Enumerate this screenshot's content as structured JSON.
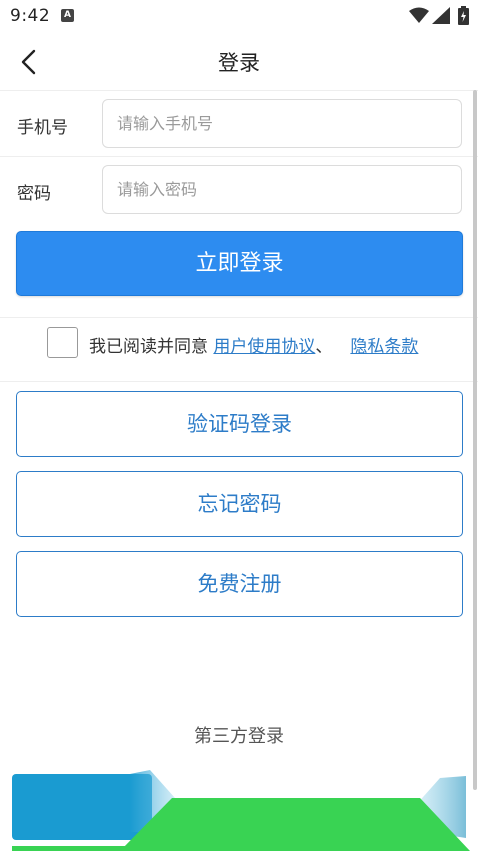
{
  "status_bar": {
    "time": "9:42",
    "notification_icon_letter": "A",
    "icons": [
      "wifi-icon",
      "signal-icon",
      "battery-charging-icon"
    ]
  },
  "header": {
    "title": "登录",
    "back_icon": "chevron-left-icon"
  },
  "form": {
    "phone_label": "手机号",
    "phone_placeholder": "请输入手机号",
    "phone_value": "",
    "password_label": "密码",
    "password_placeholder": "请输入密码",
    "password_value": ""
  },
  "login_button_label": "立即登录",
  "agreement": {
    "checked": false,
    "prefix": "我已阅读并同意",
    "user_agreement": "用户使用协议",
    "separator": "、",
    "privacy_policy": "隐私条款"
  },
  "alt_buttons": {
    "sms_login": "验证码登录",
    "forgot_password": "忘记密码",
    "register": "免费注册"
  },
  "third_party": {
    "title": "第三方登录"
  },
  "colors": {
    "primary_blue": "#2d8cf0",
    "link_blue": "#2d7cc8",
    "third_party_cyan": "#1a9bd1",
    "third_party_green": "#39d353"
  }
}
